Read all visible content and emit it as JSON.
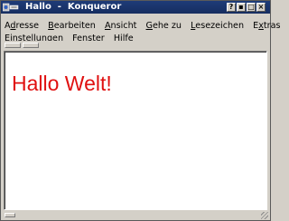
{
  "window": {
    "title": "Hallo  -  Konqueror",
    "buttons": {
      "help": "?",
      "minimize": "▪",
      "maximize": "□",
      "close": "×"
    }
  },
  "menu": {
    "row1": [
      {
        "pre": "A",
        "ul": "d",
        "post": "resse"
      },
      {
        "pre": "",
        "ul": "B",
        "post": "earbeiten"
      },
      {
        "pre": "",
        "ul": "A",
        "post": "nsicht"
      },
      {
        "pre": "",
        "ul": "G",
        "post": "ehe zu"
      },
      {
        "pre": "",
        "ul": "L",
        "post": "esezeichen"
      },
      {
        "pre": "E",
        "ul": "x",
        "post": "tras"
      }
    ],
    "row2": [
      {
        "pre": "",
        "ul": "E",
        "post": "instellungen"
      },
      {
        "pre": "",
        "ul": "F",
        "post": "enster"
      },
      {
        "pre": "",
        "ul": "H",
        "post": "ilfe"
      }
    ]
  },
  "page": {
    "heading": "Hallo Welt!",
    "heading_color": "#e01010"
  },
  "icons": {
    "app": "konqueror-icon"
  }
}
